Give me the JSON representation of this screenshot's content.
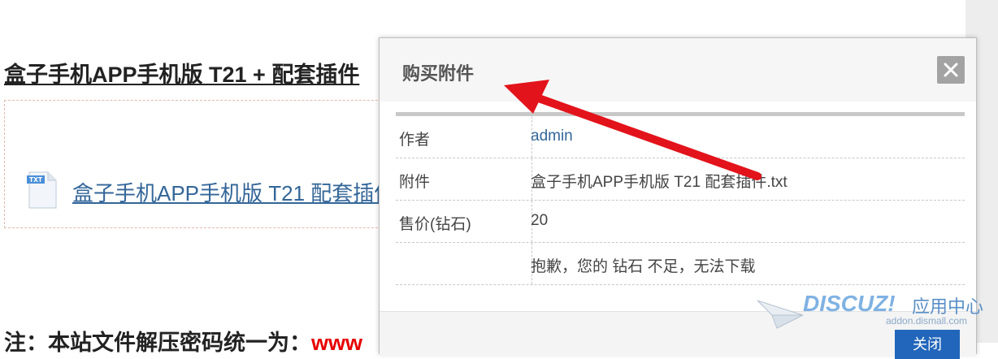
{
  "page": {
    "title": "盒子手机APP手机版 T21 + 配套插件",
    "attachment_link": "盒子手机APP手机版 T21 配套插件.txt",
    "note_prefix": "注：本站文件解压密码统一为：",
    "note_value": "www"
  },
  "dialog": {
    "title": "购买附件",
    "close_symbol": "×",
    "rows": [
      {
        "label": "作者",
        "value": "admin"
      },
      {
        "label": "附件",
        "value": "盒子手机APP手机版 T21 配套插件.txt"
      },
      {
        "label": "售价(钻石)",
        "value": "20"
      },
      {
        "label": "",
        "value": "抱歉，您的 钻石 不足，无法下载"
      }
    ],
    "footer_button": "关闭"
  },
  "watermark": {
    "brand": "DISCUZ!",
    "cn": "应用中心",
    "url": "addon.dismall.com"
  },
  "icons": {
    "file": "txt-file-icon",
    "close": "close-icon",
    "annotation": "red-arrow"
  },
  "colors": {
    "link": "#336699",
    "annotation_arrow": "#e3131b",
    "footer_button": "#2266bb",
    "note_red": "#e60000"
  }
}
